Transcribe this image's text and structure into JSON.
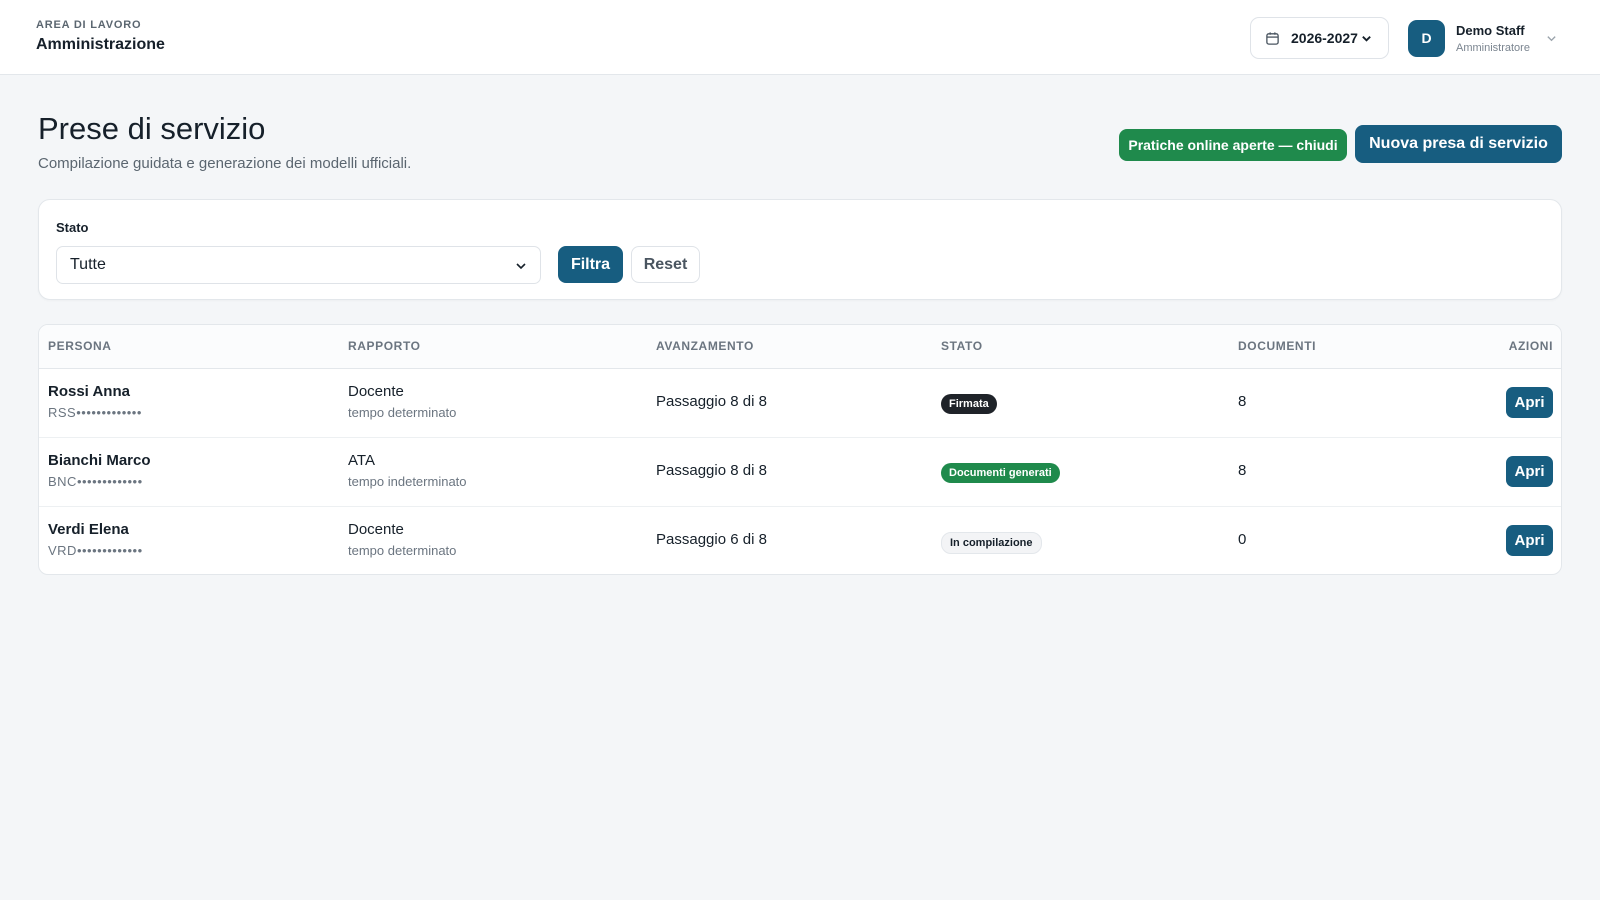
{
  "workspace": {
    "label": "AREA DI LAVORO",
    "name": "Amministrazione"
  },
  "header": {
    "year": "2026-2027",
    "calendar_icon": "calendar-icon",
    "user": {
      "initial": "D",
      "name": "Demo Staff",
      "role": "Amministratore"
    }
  },
  "page": {
    "title": "Prese di servizio",
    "subtitle": "Compilazione guidata e generazione dei modelli ufficiali.",
    "online_button": "Pratiche online aperte — chiudi",
    "new_button": "Nuova presa di servizio"
  },
  "filter": {
    "label": "Stato",
    "selected": "Tutte",
    "apply": "Filtra",
    "reset": "Reset"
  },
  "table": {
    "headers": [
      "PERSONA",
      "RAPPORTO",
      "AVANZAMENTO",
      "STATO",
      "DOCUMENTI",
      "AZIONI"
    ],
    "rows": [
      {
        "name": "Rossi Anna",
        "code": "RSS•••••••••••••",
        "role": "Docente",
        "contract": "tempo determinato",
        "progress": "Passaggio 8 di 8",
        "status": "Firmata",
        "documents": "8",
        "action": "Apri"
      },
      {
        "name": "Bianchi Marco",
        "code": "BNC•••••••••••••",
        "role": "ATA",
        "contract": "tempo indeterminato",
        "progress": "Passaggio 8 di 8",
        "status": "Documenti generati",
        "documents": "8",
        "action": "Apri"
      },
      {
        "name": "Verdi Elena",
        "code": "VRD•••••••••••••",
        "role": "Docente",
        "contract": "tempo determinato",
        "progress": "Passaggio 6 di 8",
        "status": "In compilazione",
        "documents": "0",
        "action": "Apri"
      }
    ]
  },
  "colors": {
    "primary": "#175d80",
    "success": "#1f8a4c",
    "dark_badge": "#1f2329",
    "background": "#f4f6f8"
  }
}
